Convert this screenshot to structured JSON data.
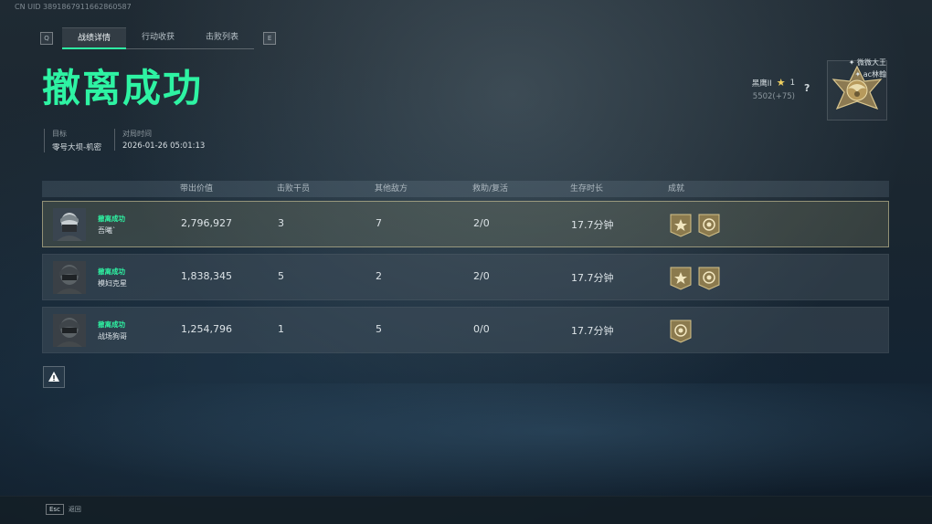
{
  "header": {
    "uid": "CN UID 3891867911662860587"
  },
  "tabs": {
    "prev_key": "Q",
    "next_key": "E",
    "items": [
      {
        "label": "战绩详情",
        "active": true
      },
      {
        "label": "行动收获",
        "active": false
      },
      {
        "label": "击败列表",
        "active": false
      }
    ]
  },
  "result": {
    "title": "撤离成功"
  },
  "meta": {
    "target_label": "目标",
    "target_value": "零号大坝-机密",
    "time_label": "对局时间",
    "time_value": "2026-01-26 05:01:13"
  },
  "rank": {
    "name": "黑鹰II",
    "stars": "1",
    "score": "5502(+75)",
    "help": "?"
  },
  "team": [
    "微微大王",
    "ac林翰"
  ],
  "table": {
    "headers": [
      "带出价值",
      "击败干员",
      "其他敌方",
      "救助/复活",
      "生存时长",
      "成就"
    ],
    "rows": [
      {
        "status": "撤离成功",
        "name": "吾曦`",
        "value": "2,796,927",
        "kills": "3",
        "others": "7",
        "assist": "2/0",
        "survival": "17.7分钟",
        "achievements": [
          "star-badge-icon",
          "medal-badge-icon"
        ],
        "highlighted": true
      },
      {
        "status": "撤离成功",
        "name": "模妇克星",
        "value": "1,838,345",
        "kills": "5",
        "others": "2",
        "assist": "2/0",
        "survival": "17.7分钟",
        "achievements": [
          "star-badge-icon",
          "medal-badge-icon"
        ],
        "highlighted": false
      },
      {
        "status": "撤离成功",
        "name": "战场狗哥",
        "value": "1,254,796",
        "kills": "1",
        "others": "5",
        "assist": "0/0",
        "survival": "17.7分钟",
        "achievements": [
          "medal-badge-icon"
        ],
        "highlighted": false
      }
    ]
  },
  "footer": {
    "esc_key": "Esc",
    "esc_label": "返回"
  },
  "colors": {
    "accent": "#2ef3a3",
    "highlight_border": "#dcd2a0",
    "badge_gold": "#c2a866"
  }
}
